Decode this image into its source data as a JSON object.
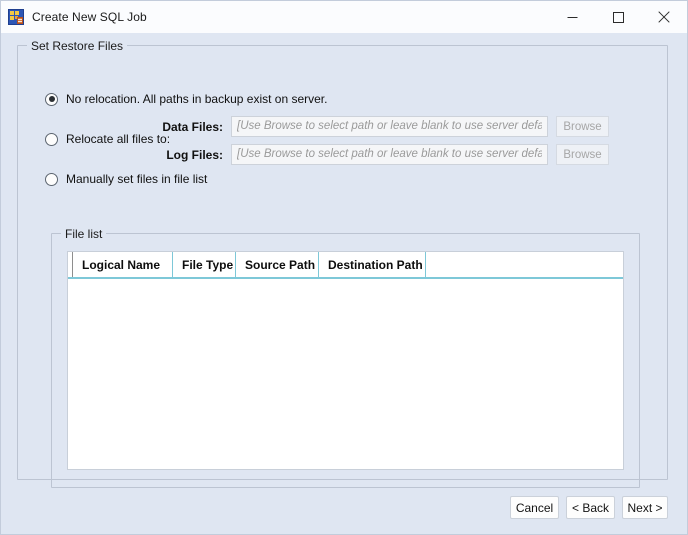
{
  "window": {
    "title": "Create New SQL Job",
    "icon": "sql-job-icon",
    "controls": {
      "minimize": "minimize-icon",
      "maximize": "maximize-icon",
      "close": "close-icon"
    }
  },
  "theme": {
    "background": "#dfe6f2",
    "titlebar": "#fbfcfe",
    "group_border": "#bcc4d2",
    "grid_accent": "#7ec8d8",
    "placeholder_text": "#9a9a9a",
    "disabled_text": "#a6a6a6"
  },
  "outer_group": {
    "title": "Set Restore Files"
  },
  "options": [
    {
      "id": "no-relocation",
      "label": "No relocation.  All paths in backup exist on server.",
      "checked": true
    },
    {
      "id": "relocate-all",
      "label": "Relocate all files to:",
      "checked": false
    },
    {
      "id": "manual-file-list",
      "label": "Manually set files in file list",
      "checked": false
    }
  ],
  "fields": {
    "placeholder": "[Use Browse to select path or leave blank to use server default]",
    "data_files": {
      "label": "Data Files:",
      "value": "",
      "browse_label": "Browse"
    },
    "log_files": {
      "label": "Log Files:",
      "value": "",
      "browse_label": "Browse"
    }
  },
  "file_list": {
    "title": "File list",
    "columns": [
      "Logical Name",
      "File Type",
      "Source Path",
      "Destination Path"
    ],
    "rows": []
  },
  "buttons": {
    "cancel": "Cancel",
    "back": "< Back",
    "next": "Next >"
  }
}
